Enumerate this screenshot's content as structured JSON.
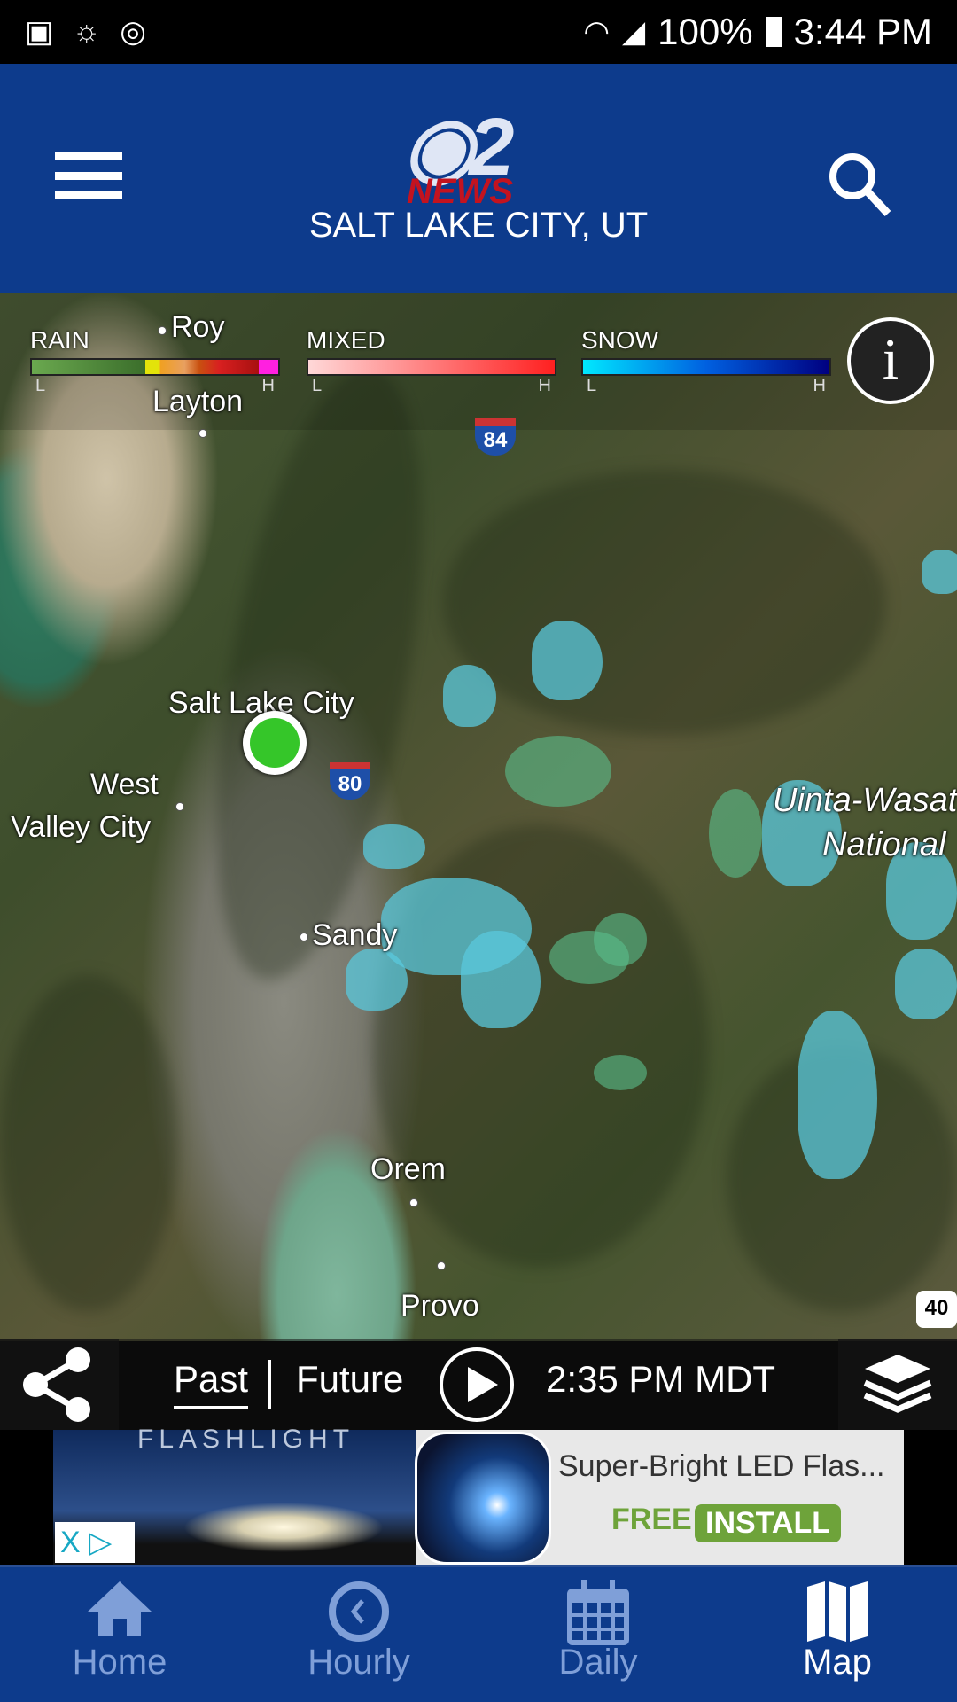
{
  "status_bar": {
    "battery": "100%",
    "time": "3:44 PM",
    "icons": [
      "gallery-icon",
      "weather-icon",
      "sync-icon",
      "wifi-icon",
      "signal-icon",
      "battery-icon"
    ]
  },
  "header": {
    "logo_text": "2",
    "logo_news": "NEWS",
    "location": "SALT LAKE CITY, UT",
    "menu_icon": "hamburger-icon",
    "search_icon": "search-icon",
    "background": "#0d3b8c"
  },
  "legend": {
    "rain": {
      "label": "RAIN",
      "low": "L",
      "high": "H",
      "colors": [
        "#6aa84f",
        "#5f9a46",
        "#548c3d",
        "#487d34",
        "#3b6e2b",
        "#2e5f22",
        "#e3e30a",
        "#f0a020",
        "#e8a060",
        "#c85010",
        "#d82020",
        "#c01818",
        "#a81010",
        "#ff20e0"
      ]
    },
    "mixed": {
      "label": "MIXED",
      "low": "L",
      "high": "H",
      "colors": [
        "#ffd8d8",
        "#ff2020"
      ]
    },
    "snow": {
      "label": "SNOW",
      "low": "L",
      "high": "H",
      "colors": [
        "#00e8ff",
        "#0060e0",
        "#000080"
      ]
    },
    "info_icon": "i"
  },
  "map": {
    "labels": [
      "Roy",
      "Layton",
      "Salt Lake City",
      "West",
      "Valley City",
      "Sandy",
      "Orem",
      "Provo",
      "Uinta-Wasat",
      "National"
    ],
    "shields": [
      "84",
      "80",
      "40"
    ],
    "location_color": "#35c629"
  },
  "controls": {
    "past": "Past",
    "future": "Future",
    "time": "2:35 PM MDT",
    "selected": "Past"
  },
  "ad": {
    "banner_text": "FLASHLIGHT",
    "title": "Super-Bright LED Flas...",
    "free": "FREE",
    "install": "INSTALL",
    "adchoices": "X ▷"
  },
  "nav": {
    "items": [
      {
        "label": "Home",
        "icon": "home-icon"
      },
      {
        "label": "Hourly",
        "icon": "clock-icon"
      },
      {
        "label": "Daily",
        "icon": "calendar-icon"
      },
      {
        "label": "Map",
        "icon": "map-icon",
        "active": true
      }
    ]
  }
}
